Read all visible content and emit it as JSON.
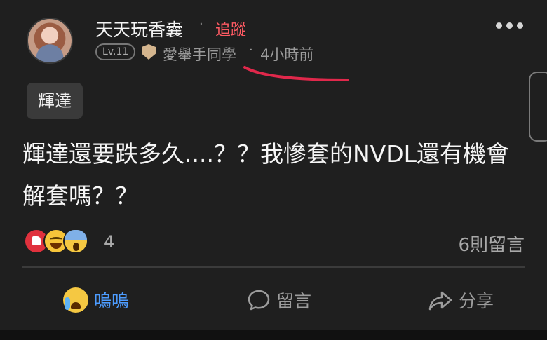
{
  "post": {
    "author": "天天玩香囊",
    "separator": "·",
    "follow_label": "追蹤",
    "level": "Lv.11",
    "board": "愛舉手同學",
    "time": "4小時前",
    "tag": "輝達",
    "content": "輝達還要跌多久....？？我慘套的NVDL還有機會解套嗎？？",
    "reaction_count": "4",
    "comments_count": "6則留言"
  },
  "reactions": [
    "like-reaction-icon",
    "laugh-reaction-icon",
    "scream-reaction-icon"
  ],
  "actions": {
    "cry_label": "嗚嗚",
    "comment_label": "留言",
    "share_label": "分享"
  },
  "colors": {
    "background": "#1f1f1f",
    "follow": "#ff5a63",
    "active_action": "#4d9cff",
    "annotation": "#e0284b"
  }
}
